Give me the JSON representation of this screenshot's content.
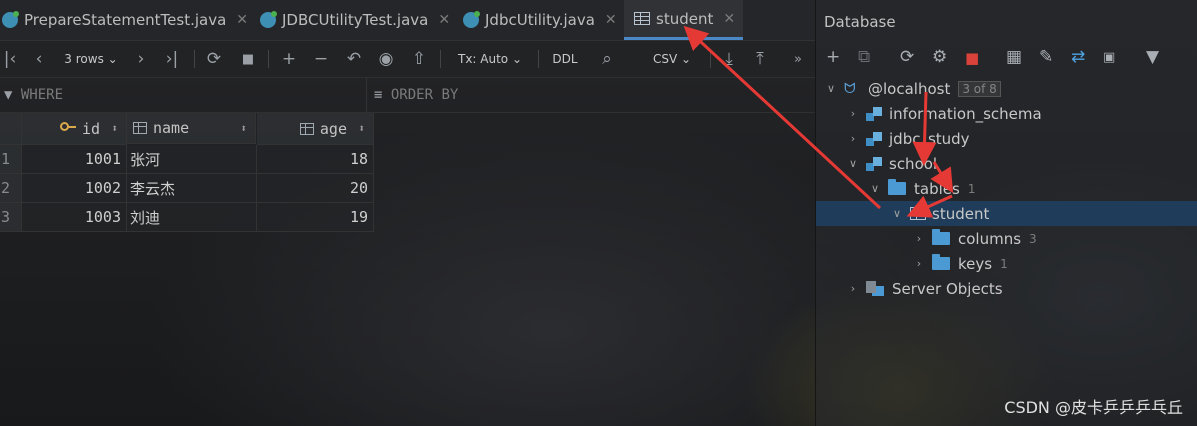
{
  "tabs": [
    {
      "label": "PrepareStatementTest.java",
      "icon": "java-class-icon"
    },
    {
      "label": "JDBCUtilityTest.java",
      "icon": "java-class-icon"
    },
    {
      "label": "JdbcUtility.java",
      "icon": "java-class-icon"
    },
    {
      "label": "student",
      "icon": "table-icon",
      "active": true
    }
  ],
  "toolbar": {
    "rows_label": "3 rows",
    "tx_label": "Tx: Auto",
    "ddl_label": "DDL",
    "csv_label": "CSV"
  },
  "filter": {
    "where": "WHERE",
    "order_by": "ORDER BY"
  },
  "grid": {
    "columns": [
      "id",
      "name",
      "age"
    ],
    "rows": [
      {
        "n": "1",
        "id": "1001",
        "name": "张河",
        "age": "18"
      },
      {
        "n": "2",
        "id": "1002",
        "name": "李云杰",
        "age": "20"
      },
      {
        "n": "3",
        "id": "1003",
        "name": "刘迪",
        "age": "19"
      }
    ]
  },
  "database": {
    "title": "Database",
    "host": "@localhost",
    "host_badge": "3 of 8",
    "schemas": [
      "information_schema",
      "jdbc_study",
      "school"
    ],
    "tables_label": "tables",
    "tables_count": "1",
    "table": "student",
    "columns_label": "columns",
    "columns_count": "3",
    "keys_label": "keys",
    "keys_count": "1",
    "server_objects": "Server Objects"
  },
  "watermark": "CSDN @皮卡乒乒乒乓丘",
  "colors": {
    "accent": "#4a88c7",
    "selection": "#1f3d5a",
    "arrow": "#e53935"
  }
}
